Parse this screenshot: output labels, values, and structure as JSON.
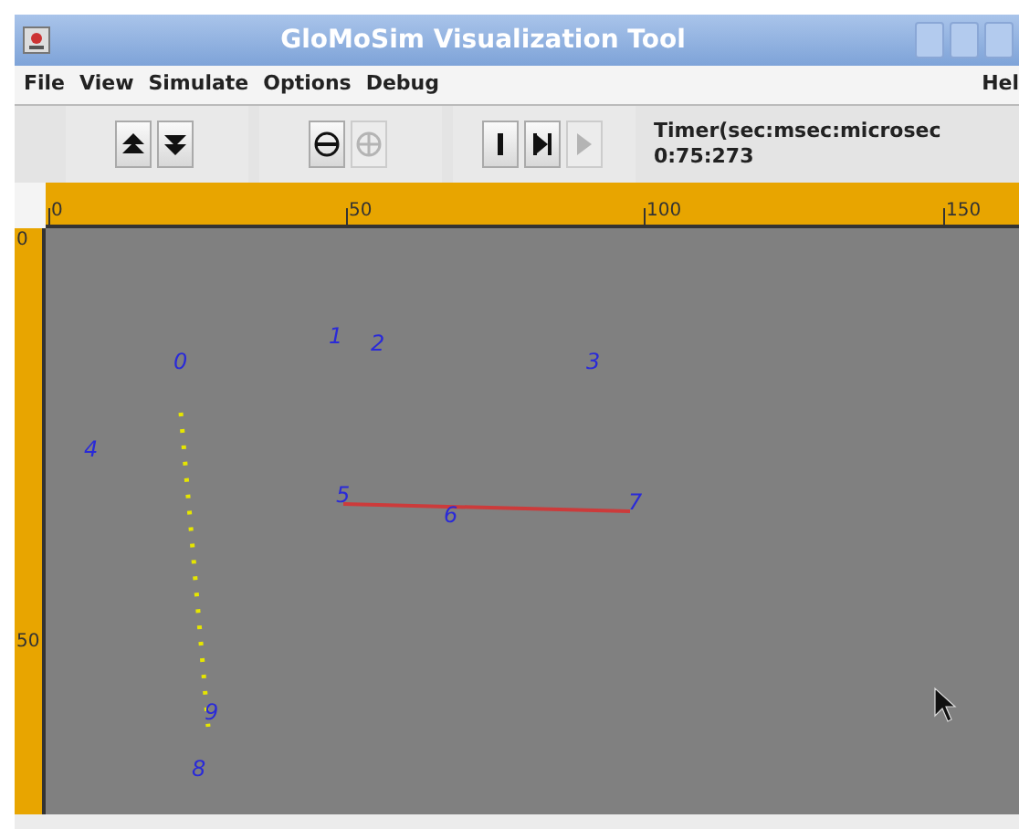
{
  "window": {
    "title": "GloMoSim Visualization Tool"
  },
  "menu": [
    {
      "label": "File"
    },
    {
      "label": "View"
    },
    {
      "label": "Simulate"
    },
    {
      "label": "Options"
    },
    {
      "label": "Debug"
    },
    {
      "label": "Hel"
    }
  ],
  "toolbar": [
    {
      "kind": "up",
      "disabled": false
    },
    {
      "kind": "down",
      "disabled": false
    },
    {
      "kind": "zoom-out",
      "disabled": false
    },
    {
      "kind": "zoom-in",
      "disabled": true
    },
    {
      "kind": "pause",
      "disabled": false
    },
    {
      "kind": "step",
      "disabled": false
    },
    {
      "kind": "play",
      "disabled": true
    }
  ],
  "timer": {
    "label": "Timer(sec:msec:microsec",
    "value": "0:75:273"
  },
  "ruler": {
    "x_ticks": [
      "0",
      "50",
      "100",
      "150"
    ],
    "y_ticks": [
      "0",
      "50"
    ]
  },
  "nodes": [
    {
      "label": "0"
    },
    {
      "label": "1"
    },
    {
      "label": "2"
    },
    {
      "label": "3"
    },
    {
      "label": "4"
    },
    {
      "label": "5"
    },
    {
      "label": "6"
    },
    {
      "label": "7"
    },
    {
      "label": "8"
    },
    {
      "label": "9"
    }
  ],
  "links": [
    {
      "kind": "dotted",
      "color": "#e6e600"
    },
    {
      "kind": "solid",
      "color": "#cc3b3b"
    }
  ]
}
